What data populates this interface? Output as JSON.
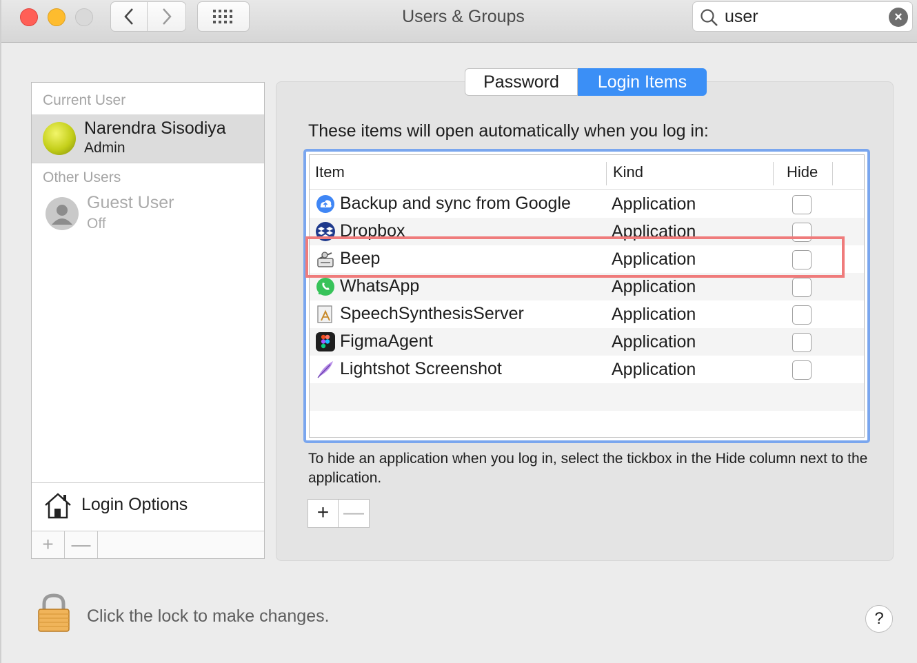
{
  "window": {
    "title": "Users & Groups",
    "search_value": "user"
  },
  "sidebar": {
    "current_user_label": "Current User",
    "current_user": {
      "name": "Narendra Sisodiya",
      "role": "Admin"
    },
    "other_users_label": "Other Users",
    "other_users": [
      {
        "name": "Guest User",
        "state": "Off"
      }
    ],
    "login_options_label": "Login Options",
    "add_label": "+",
    "remove_label": "—"
  },
  "tabs": [
    {
      "label": "Password",
      "active": false
    },
    {
      "label": "Login Items",
      "active": true
    }
  ],
  "login_items": {
    "intro": "These items will open automatically when you log in:",
    "columns": {
      "item": "Item",
      "kind": "Kind",
      "hide": "Hide"
    },
    "rows": [
      {
        "name": "Backup and sync from Google",
        "kind": "Application",
        "hide": false,
        "icon": "google-backup-icon"
      },
      {
        "name": "Dropbox",
        "kind": "Application",
        "hide": false,
        "icon": "dropbox-icon"
      },
      {
        "name": "Beep",
        "kind": "Application",
        "hide": false,
        "icon": "beep-icon"
      },
      {
        "name": "WhatsApp",
        "kind": "Application",
        "hide": false,
        "icon": "whatsapp-icon"
      },
      {
        "name": "SpeechSynthesisServer",
        "kind": "Application",
        "hide": false,
        "icon": "speech-synthesis-icon"
      },
      {
        "name": "FigmaAgent",
        "kind": "Application",
        "hide": false,
        "icon": "figma-icon"
      },
      {
        "name": "Lightshot Screenshot",
        "kind": "Application",
        "hide": false,
        "icon": "lightshot-icon"
      }
    ],
    "hint": "To hide an application when you log in, select the tickbox in the Hide column next to the application.",
    "add_label": "+",
    "remove_label": "—"
  },
  "footer": {
    "lock_text": "Click the lock to make changes.",
    "help_label": "?"
  },
  "colors": {
    "accent": "#3b8ff6",
    "table_focus": "#7aa6ee",
    "annotation": "#ef7b7b"
  }
}
